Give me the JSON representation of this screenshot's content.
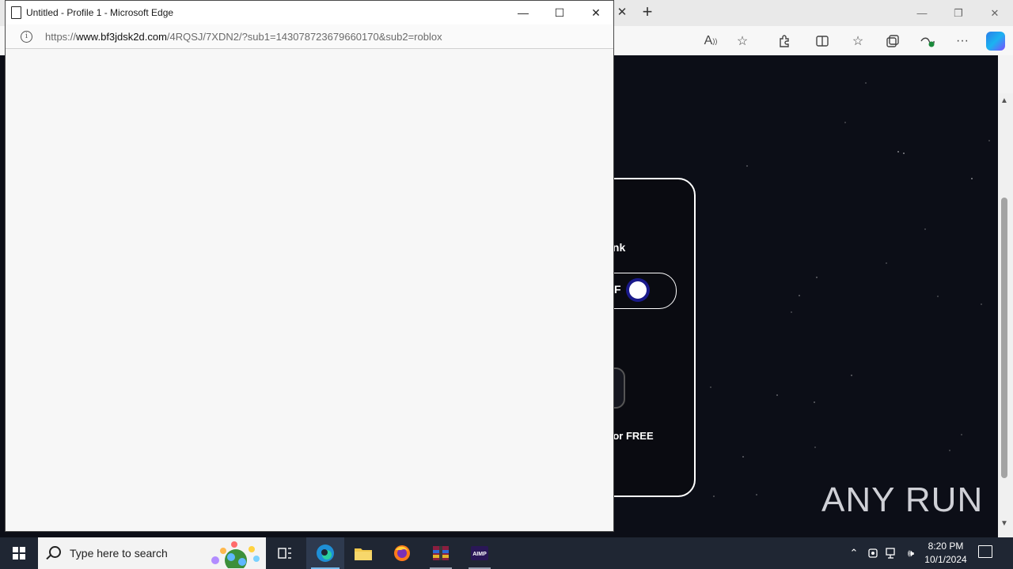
{
  "background_browser": {
    "page_heading_fragment": "ink",
    "toggle_label_fragment": "F",
    "footer_text_fragment": "for FREE",
    "watermark": "ANY RUN"
  },
  "popup": {
    "title": "Untitled - Profile 1 - Microsoft Edge",
    "url_proto": "https://",
    "url_host": "www.bf3jdsk2d.com",
    "url_path": "/4RQSJ/7XDN2/?sub1=143078723679660170&sub2=roblox"
  },
  "taskbar": {
    "search_placeholder": "Type here to search",
    "time": "8:20 PM",
    "date": "10/1/2024",
    "apps": [
      "task-view",
      "edge",
      "file-explorer",
      "firefox",
      "winrar",
      "aimp"
    ]
  },
  "colors": {
    "taskbar_bg": "#1f2633",
    "page_bg": "#0c0e17",
    "popup_bg": "#f7f7f7"
  }
}
